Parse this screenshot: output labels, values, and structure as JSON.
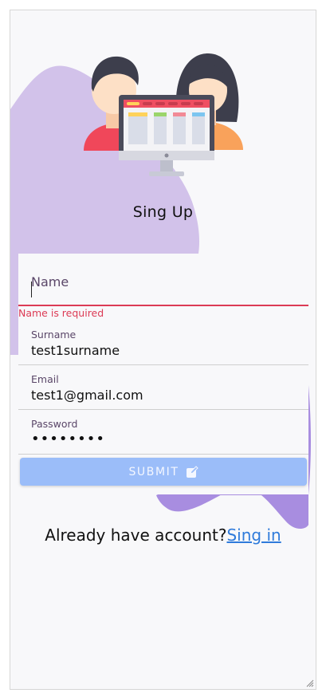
{
  "page": {
    "title": "Sing Up"
  },
  "form": {
    "name": {
      "label": "Name",
      "value": "",
      "error": "Name is required"
    },
    "surname": {
      "label": "Surname",
      "value": "test1surname"
    },
    "email": {
      "label": "Email",
      "value": "test1@gmail.com"
    },
    "password": {
      "label": "Password",
      "value": "••••••••"
    },
    "submit_label": "SUBMIT",
    "submit_icon": "edit-icon"
  },
  "footer": {
    "text": "Already have account?",
    "link": "Sing in"
  },
  "colors": {
    "accent": "#9bbdf9",
    "error": "#dc3b55",
    "link": "#2f7bdb",
    "blob_top": "#d2c2ea",
    "blob_bottom": "#a88de0"
  }
}
